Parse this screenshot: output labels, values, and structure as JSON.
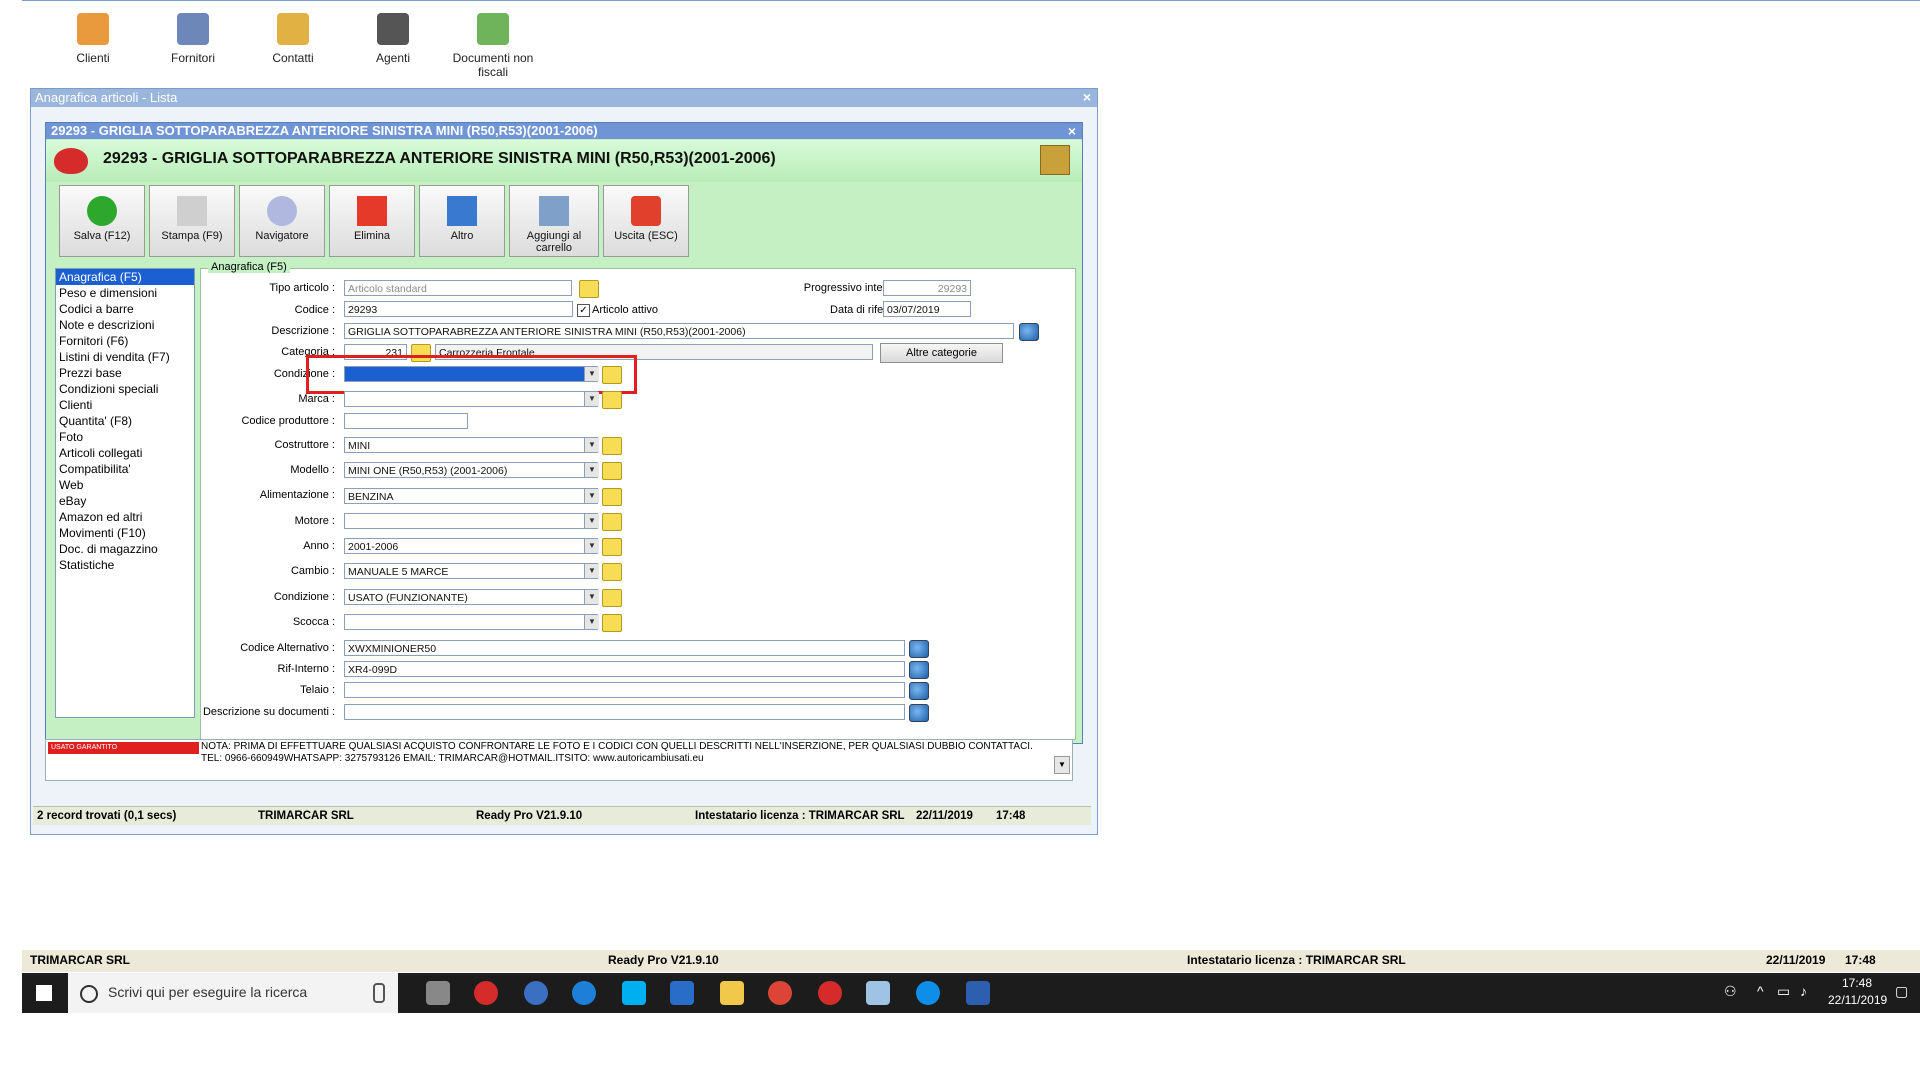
{
  "desktop_toolbar": [
    {
      "label": "Clienti"
    },
    {
      "label": "Fornitori"
    },
    {
      "label": "Contatti"
    },
    {
      "label": "Agenti"
    },
    {
      "label": "Documenti non fiscali"
    }
  ],
  "outer_window": {
    "title": "Anagrafica articoli  - Lista"
  },
  "inner_window": {
    "title": "29293 - GRIGLIA SOTTOPARABREZZA ANTERIORE SINISTRA MINI (R50,R53)(2001-2006)",
    "header": "29293 - GRIGLIA SOTTOPARABREZZA ANTERIORE SINISTRA MINI (R50,R53)(2001-2006)"
  },
  "commands": [
    {
      "label": "Salva (F12)"
    },
    {
      "label": "Stampa (F9)"
    },
    {
      "label": "Navigatore"
    },
    {
      "label": "Elimina"
    },
    {
      "label": "Altro"
    },
    {
      "label": "Aggiungi al carrello"
    },
    {
      "label": "Uscita (ESC)"
    }
  ],
  "nav": {
    "items": [
      "Anagrafica (F5)",
      "Peso e dimensioni",
      "Codici a barre",
      "Note e descrizioni",
      "Fornitori (F6)",
      "Listini di vendita (F7)",
      "Prezzi base",
      "Condizioni speciali",
      "Clienti",
      "Quantita' (F8)",
      "Foto",
      "Articoli collegati",
      "Compatibilita'",
      "Web",
      "eBay",
      "Amazon ed altri",
      "Movimenti (F10)",
      "Doc. di magazzino",
      "Statistiche"
    ],
    "selected": 0
  },
  "form": {
    "group_label": "Anagrafica (F5)",
    "tipo_articolo": {
      "label": "Tipo articolo :",
      "value": "Articolo standard"
    },
    "codice": {
      "label": "Codice :",
      "value": "29293"
    },
    "articolo_attivo": {
      "label": "Articolo attivo",
      "checked": true
    },
    "progressivo": {
      "label": "Progressivo interno (ID) :",
      "value": "29293"
    },
    "data_riferimento": {
      "label": "Data di riferimento :",
      "value": "03/07/2019"
    },
    "descrizione": {
      "label": "Descrizione :",
      "value": "GRIGLIA SOTTOPARABREZZA ANTERIORE SINISTRA MINI (R50,R53)(2001-2006)"
    },
    "categoria": {
      "label": "Categoria :",
      "code": "231",
      "name": "Carrozzeria Frontale"
    },
    "altre_categorie": "Altre categorie",
    "condizione_top": {
      "label": "Condizione :",
      "value": ""
    },
    "marca": {
      "label": "Marca :",
      "value": ""
    },
    "codice_produttore": {
      "label": "Codice produttore :",
      "value": ""
    },
    "costruttore": {
      "label": "Costruttore :",
      "value": "MINI"
    },
    "modello": {
      "label": "Modello :",
      "value": "MINI ONE (R50,R53) (2001-2006)"
    },
    "alimentazione": {
      "label": "Alimentazione :",
      "value": "BENZINA"
    },
    "motore": {
      "label": "Motore :",
      "value": ""
    },
    "anno": {
      "label": "Anno :",
      "value": "2001-2006"
    },
    "cambio": {
      "label": "Cambio :",
      "value": "MANUALE 5 MARCE"
    },
    "condizione": {
      "label": "Condizione :",
      "value": "USATO (FUNZIONANTE)"
    },
    "scocca": {
      "label": "Scocca :",
      "value": ""
    },
    "codice_alternativo": {
      "label": "Codice Alternativo :",
      "value": "XWXMINIONER50"
    },
    "rif_interno": {
      "label": "Rif-Interno :",
      "value": "XR4-099D"
    },
    "telaio": {
      "label": "Telaio :",
      "value": ""
    },
    "descrizione_documenti": {
      "label": "Descrizione su documenti :",
      "value": ""
    }
  },
  "note": {
    "line1": "NOTA: PRIMA DI EFFETTUARE QUALSIASI ACQUISTO CONFRONTARE LE FOTO E I CODICI CON QUELLI DESCRITTI NELL'INSERZIONE, PER QUALSIASI DUBBIO CONTATTACI.",
    "line2": "TEL: 0966-660949WHATSAPP: 3275793126     EMAIL: TRIMARCAR@HOTMAIL.ITSITO:  www.autoricambiusati.eu",
    "badge": "USATO GARANTITO"
  },
  "status_inner": {
    "records": "2 record trovati (0,1 secs)",
    "company": "TRIMARCAR SRL",
    "version": "Ready Pro V21.9.10",
    "license": "Intestatario licenza : TRIMARCAR SRL",
    "date": "22/11/2019",
    "time": "17:48"
  },
  "status_main": {
    "company": "TRIMARCAR SRL",
    "version": "Ready Pro V21.9.10",
    "license": "Intestatario licenza : TRIMARCAR SRL",
    "date": "22/11/2019",
    "time": "17:48"
  },
  "taskbar": {
    "search_placeholder": "Scrivi qui per eseguire la ricerca",
    "clock_time": "17:48",
    "clock_date": "22/11/2019"
  },
  "colors": {
    "accent": "#1b5fd0",
    "form_bg": "#c4f0c4",
    "highlight": "#e0201f",
    "taskbar": "#1c1c1c"
  }
}
